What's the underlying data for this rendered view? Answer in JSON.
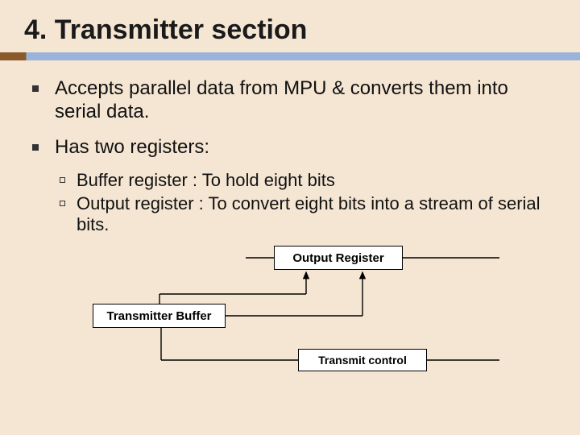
{
  "title": "4. Transmitter section",
  "bullets": {
    "b1": "Accepts parallel data from MPU & converts them into serial data.",
    "b2": "Has two registers:",
    "sub1": "Buffer register : To hold eight bits",
    "sub2": "Output register : To convert eight bits into a stream of serial bits."
  },
  "diagram": {
    "output_register": "Output  Register",
    "transmitter_buffer": "Transmitter Buffer",
    "transmit_control": "Transmit control"
  }
}
